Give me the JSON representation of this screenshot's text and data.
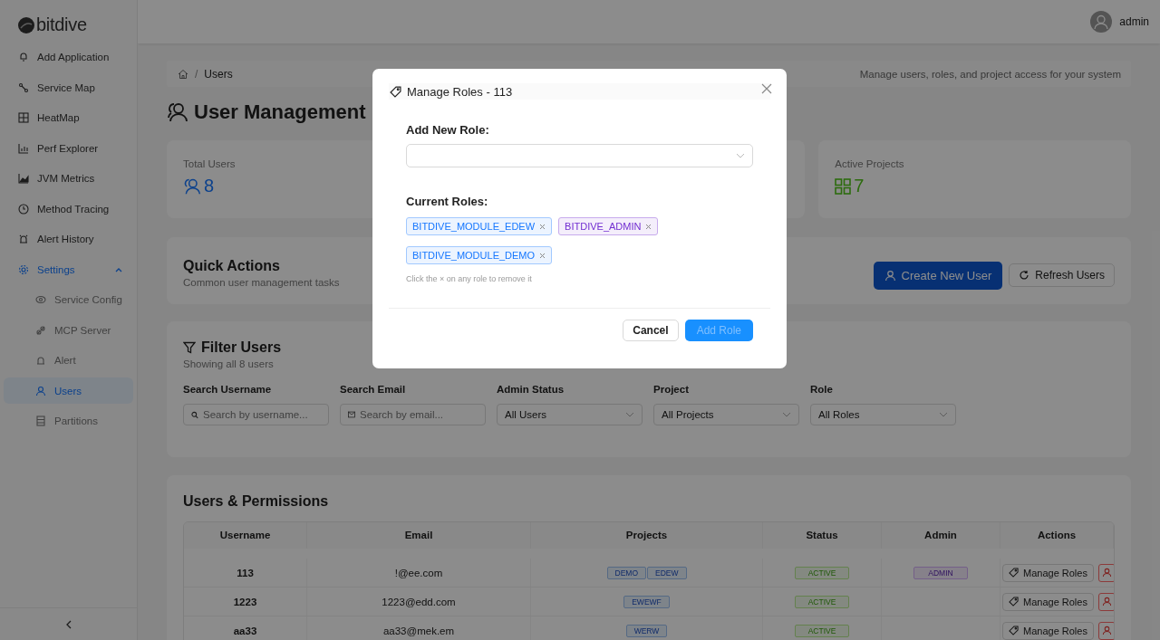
{
  "sidebar": {
    "logo": "bitdive",
    "items": [
      {
        "label": "Add Application",
        "selected": false
      },
      {
        "label": "Service Map",
        "selected": false
      },
      {
        "label": "HeatMap",
        "selected": false
      },
      {
        "label": "Perf Explorer",
        "selected": false
      },
      {
        "label": "JVM Metrics",
        "selected": false
      },
      {
        "label": "Method Tracing",
        "selected": false
      },
      {
        "label": "Alert History",
        "selected": false
      },
      {
        "label": "Settings",
        "expanded": true,
        "children": [
          {
            "label": "Service Config",
            "selected": false
          },
          {
            "label": "MCP Server",
            "selected": false
          },
          {
            "label": "Alert",
            "selected": false
          },
          {
            "label": "Users",
            "selected": true
          },
          {
            "label": "Partitions",
            "selected": false
          }
        ]
      }
    ]
  },
  "header": {
    "user": "admin"
  },
  "breadcrumb": {
    "separator": "/",
    "items": [
      "Users"
    ],
    "subtitle": "Manage users, roles, and project access for your system"
  },
  "page_title": "User Management",
  "stats": [
    {
      "label": "Total Users",
      "value": "8"
    },
    {
      "label": "Active Projects",
      "value": "7"
    }
  ],
  "quick_actions": {
    "title": "Quick Actions",
    "subtitle": "Common user management tasks",
    "buttons": [
      {
        "label": "Create New User",
        "kind": "primary"
      },
      {
        "label": "Refresh Users",
        "kind": "default"
      }
    ]
  },
  "filters": {
    "title": "Filter Users",
    "subtitle": "Showing all 8 users",
    "fields": [
      {
        "label": "Search Username",
        "kind": "search",
        "placeholder": "Search by username..."
      },
      {
        "label": "Search Email",
        "kind": "email",
        "placeholder": "Search by email..."
      },
      {
        "label": "Admin Status",
        "kind": "select",
        "value": "All Users"
      },
      {
        "label": "Project",
        "kind": "select",
        "value": "All Projects"
      },
      {
        "label": "Role",
        "kind": "select",
        "value": "All Roles"
      }
    ]
  },
  "table": {
    "title": "Users & Permissions",
    "columns": [
      "Username",
      "Email",
      "Projects",
      "Status",
      "Admin",
      "Actions"
    ],
    "rows": [
      {
        "username": "113",
        "email": "!@ee.com",
        "projects": [
          "DEMO",
          "EDEW"
        ],
        "status": "ACTIVE",
        "admin": "ADMIN",
        "action": "Manage Roles"
      },
      {
        "username": "1223",
        "email": "1223@edd.com",
        "projects": [
          "EWEWF"
        ],
        "status": "ACTIVE",
        "action": "Manage Roles"
      },
      {
        "username": "aa33",
        "email": "aa33@mek.em",
        "projects": [
          "WERW"
        ],
        "status": "ACTIVE",
        "action": "Manage Roles"
      }
    ]
  },
  "modal": {
    "title": "Manage Roles - 113",
    "add_label": "Add New Role:",
    "current_label": "Current Roles:",
    "roles": [
      {
        "label": "BITDIVE_MODULE_EDEW",
        "color": "#1677ff"
      },
      {
        "label": "BITDIVE_ADMIN",
        "color": "#722ed1"
      },
      {
        "label": "BITDIVE_MODULE_DEMO",
        "color": "#1677ff"
      }
    ],
    "hint": "Click the × on any role to remove it",
    "buttons": [
      {
        "label": "Cancel",
        "kind": "default",
        "disabled": false
      },
      {
        "label": "Add Role",
        "kind": "primary",
        "disabled": true
      }
    ]
  }
}
